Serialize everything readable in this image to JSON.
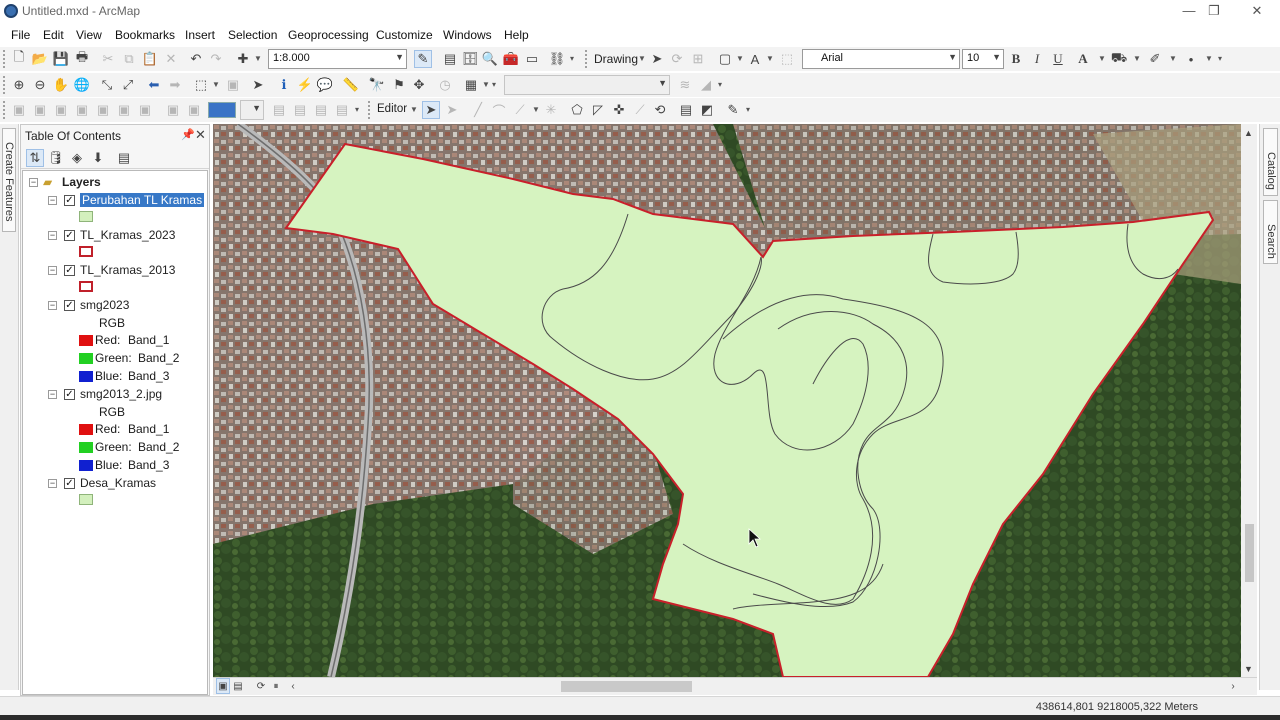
{
  "window": {
    "title": "Untitled.mxd - ArcMap",
    "controls": {
      "minimize": "—",
      "maximize": "❐",
      "close": "✕"
    }
  },
  "menu": [
    "File",
    "Edit",
    "View",
    "Bookmarks",
    "Insert",
    "Selection",
    "Geoprocessing",
    "Customize",
    "Windows",
    "Help"
  ],
  "toolbar": {
    "scale": "1:8.000",
    "drawing_label": "Drawing",
    "font_name": "Arial",
    "font_size": "10",
    "bold": "B",
    "italic": "I",
    "underline": "U",
    "text_color_glyph": "A",
    "editor_label": "Editor",
    "colors": {
      "font_color": "#1f1f1f",
      "fill_color": "#e63030",
      "line_color": "#e0c020",
      "marker_color": "#1ea01e",
      "fill_swatch": "#3a73c6"
    }
  },
  "left_dock": {
    "create_features_tab": "Create Features"
  },
  "toc": {
    "title": "Table Of Contents",
    "pin_icon": "pin-icon",
    "close_icon": "close-icon",
    "root_label": "Layers",
    "layers": [
      {
        "name": "Perubahan TL Kramas",
        "checked": true,
        "selected": true,
        "symbol": {
          "fill": "#d3f0bd",
          "stroke": "#8fb47a"
        }
      },
      {
        "name": "TL_Kramas_2023",
        "checked": true,
        "selected": false,
        "symbol": {
          "fill": "#ffffff",
          "stroke": "#c0202a"
        }
      },
      {
        "name": "TL_Kramas_2013",
        "checked": true,
        "selected": false,
        "symbol": {
          "fill": "#ffffff",
          "stroke": "#c0202a"
        }
      },
      {
        "name": "smg2023",
        "checked": true,
        "selected": false,
        "rgb_label": "RGB",
        "bands": [
          {
            "channel": "Red:",
            "band": "Band_1",
            "color": "#e01010"
          },
          {
            "channel": "Green:",
            "band": "Band_2",
            "color": "#22d022"
          },
          {
            "channel": "Blue:",
            "band": "Band_3",
            "color": "#1020d0"
          }
        ]
      },
      {
        "name": "smg2013_2.jpg",
        "checked": true,
        "selected": false,
        "rgb_label": "RGB",
        "bands": [
          {
            "channel": "Red:",
            "band": "Band_1",
            "color": "#e01010"
          },
          {
            "channel": "Green:",
            "band": "Band_2",
            "color": "#22d022"
          },
          {
            "channel": "Blue:",
            "band": "Band_3",
            "color": "#1020d0"
          }
        ]
      },
      {
        "name": "Desa_Kramas",
        "checked": true,
        "selected": false,
        "symbol": {
          "fill": "#d3f0bd",
          "stroke": "#8fb47a"
        }
      }
    ]
  },
  "map": {
    "polygon_fill": "#d6f3c0",
    "polygon_stroke": "#c8202a",
    "boundary_line_color": "#4a4a4a"
  },
  "right_dock": {
    "tabs": [
      "Catalog",
      "Search"
    ]
  },
  "status": {
    "coordinates": "438614,801  9218005,322 Meters"
  }
}
